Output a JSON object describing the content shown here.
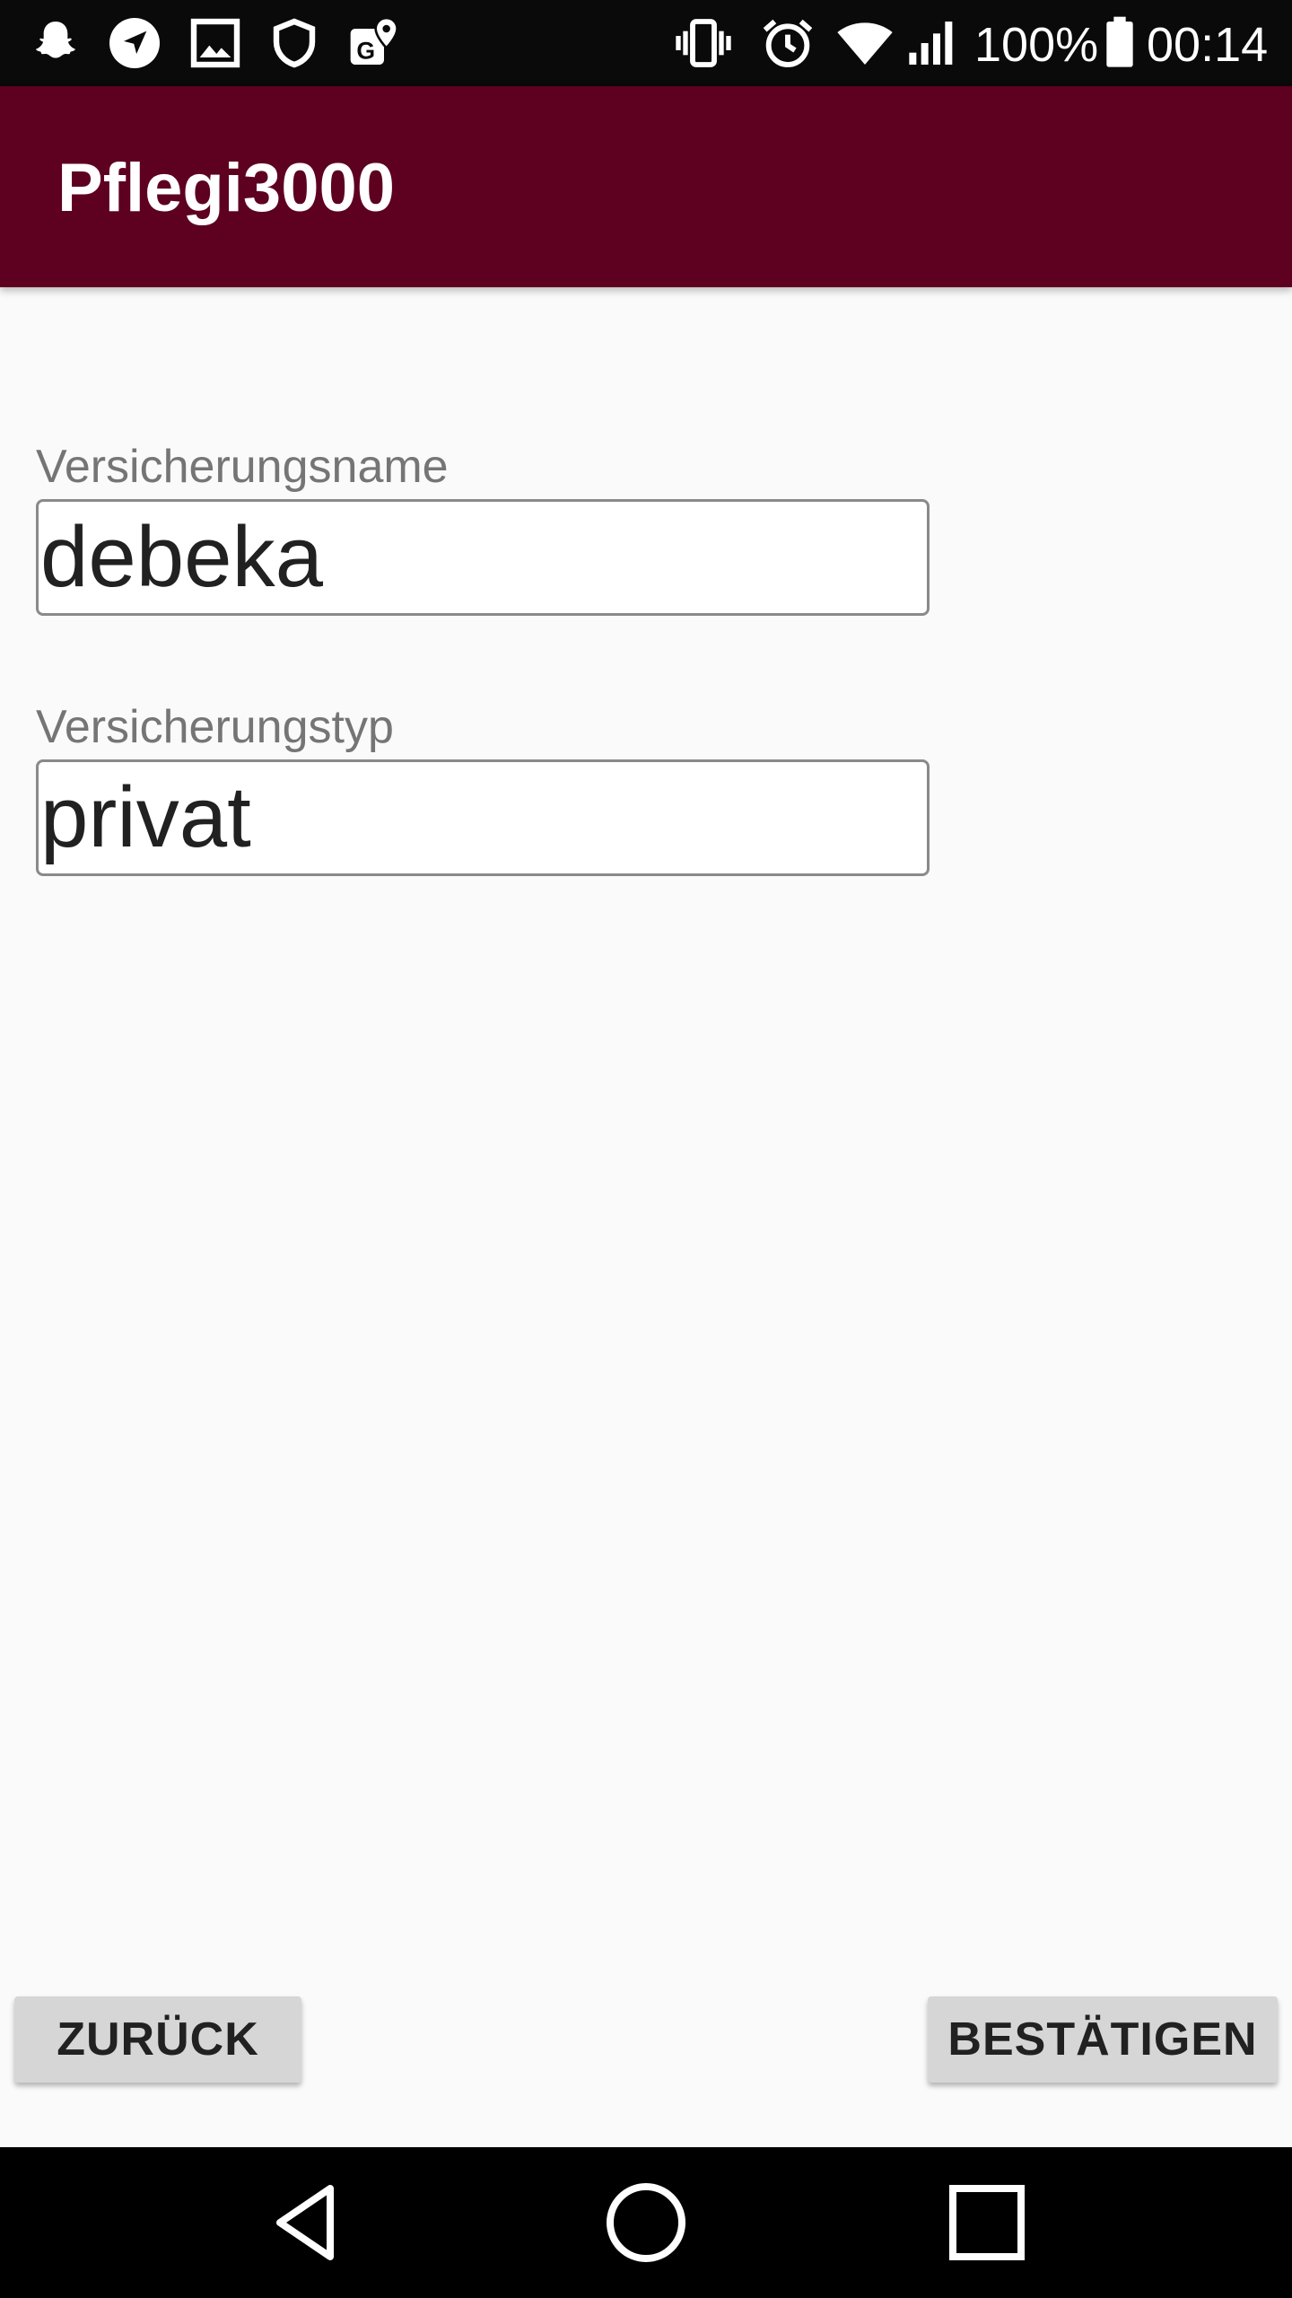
{
  "status_bar": {
    "icons_left": [
      "snapchat-icon",
      "navigation-icon",
      "image-icon",
      "shield-icon",
      "google-maps-icon"
    ],
    "icons_right": [
      "vibrate-icon",
      "alarm-icon",
      "wifi-icon",
      "signal-icon",
      "battery-icon"
    ],
    "battery": "100%",
    "time": "00:14"
  },
  "app_bar": {
    "title": "Pflegi3000",
    "color": "#5e0020"
  },
  "form": {
    "name_label": "Versicherungsname",
    "name_value": "debeka",
    "type_label": "Versicherungstyp",
    "type_value": "privat"
  },
  "buttons": {
    "back_label": "ZURÜCK",
    "confirm_label": "BESTÄTIGEN"
  },
  "nav_bar": {
    "icons": [
      "back-triangle-icon",
      "home-circle-icon",
      "recents-square-icon"
    ]
  }
}
